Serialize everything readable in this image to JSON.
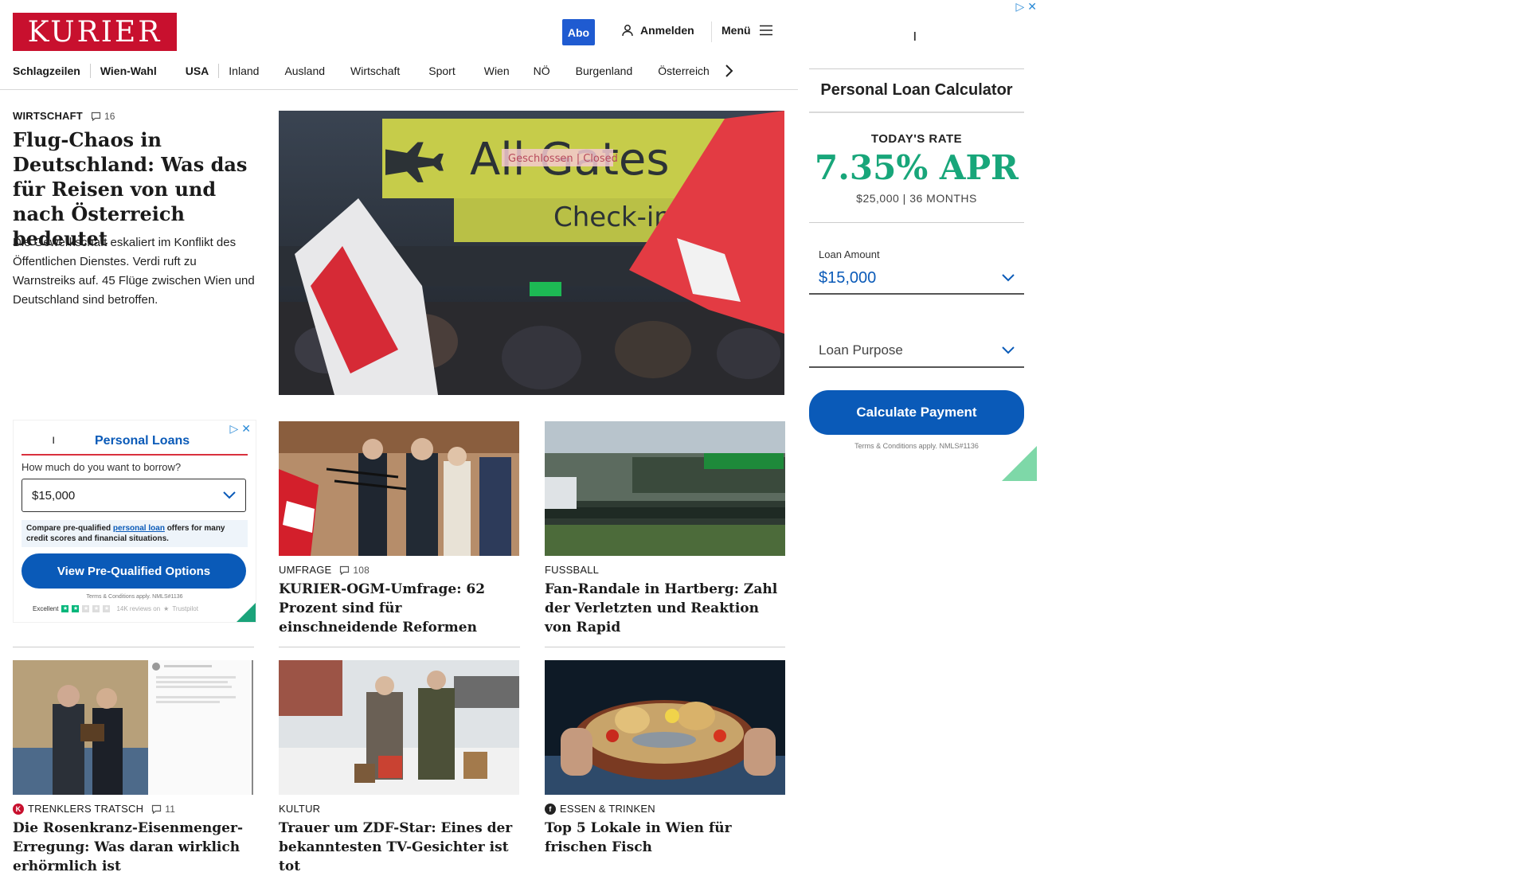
{
  "header": {
    "logo": "KURIER",
    "abo": "Abo",
    "login": "Anmelden",
    "menu": "Menü"
  },
  "nav": {
    "items": [
      "Schlagzeilen",
      "Wien-Wahl",
      "USA",
      "Inland",
      "Ausland",
      "Wirtschaft",
      "Sport",
      "Wien",
      "NÖ",
      "Burgenland",
      "Österreich"
    ]
  },
  "lead": {
    "kicker": "WIRTSCHAFT",
    "comments": "16",
    "title": "Flug-Chaos in Deutschland: Was das für Reisen von und nach Österreich bedeutet",
    "text": "Die Gewerkschaft eskaliert im Konflikt des Öffentlichen Dienstes. Verdi ruft zu Warnstreiks auf. 45 Flüge zwischen Wien und Deutschland sind betroffen.",
    "image_sign_main": "All Gates",
    "image_sign_overlay": "Geschlossen | Closed",
    "image_sign_sub": "Check-in"
  },
  "cards": [
    {
      "kicker": "UMFRAGE",
      "comments": "108",
      "title": "KURIER-OGM-Umfrage: 62 Prozent sind für einschneidende Reformen"
    },
    {
      "kicker": "FUSSBALL",
      "comments": "",
      "title": "Fan-Randale in Hartberg: Zahl der Verletzten und Reaktion von Rapid"
    },
    {
      "kicker": "TRENKLERS TRATSCH",
      "comments": "11",
      "title": "Die Rosenkranz-Eisenmenger-Erregung: Was daran wirklich erhörmlich ist"
    },
    {
      "kicker": "KULTUR",
      "comments": "",
      "title": "Trauer um ZDF-Star: Eines der bekanntesten TV-Gesichter ist tot"
    },
    {
      "kicker": "ESSEN & TRINKEN",
      "comments": "",
      "title": "Top 5 Lokale in Wien für frischen Fisch"
    }
  ],
  "ad_small": {
    "title": "Personal Loans",
    "question": "How much do you want to borrow?",
    "amount": "$15,000",
    "note_pre": "Compare pre-qualified ",
    "note_link": "personal loan",
    "note_post": " offers for many credit scores and financial situations.",
    "button": "View Pre-Qualified Options",
    "terms": "Terms & Conditions apply. NMLS#1136",
    "rating_label": "Excellent",
    "reviews": "14K reviews on",
    "trustpilot": "Trustpilot"
  },
  "ad_right": {
    "title": "Personal Loan Calculator",
    "rate_label": "TODAY'S RATE",
    "rate": "7.35% APR",
    "rate_detail": "$25,000 | 36 MONTHS",
    "amount_label": "Loan Amount",
    "amount": "$15,000",
    "purpose_label": "Loan Purpose",
    "button": "Calculate Payment",
    "terms": "Terms & Conditions apply. NMLS#1136"
  },
  "colors": {
    "brand_red": "#c8102e",
    "abo_blue": "#1f5bd1",
    "ad_blue": "#0a5ab8",
    "rate_green": "#18a67a"
  }
}
